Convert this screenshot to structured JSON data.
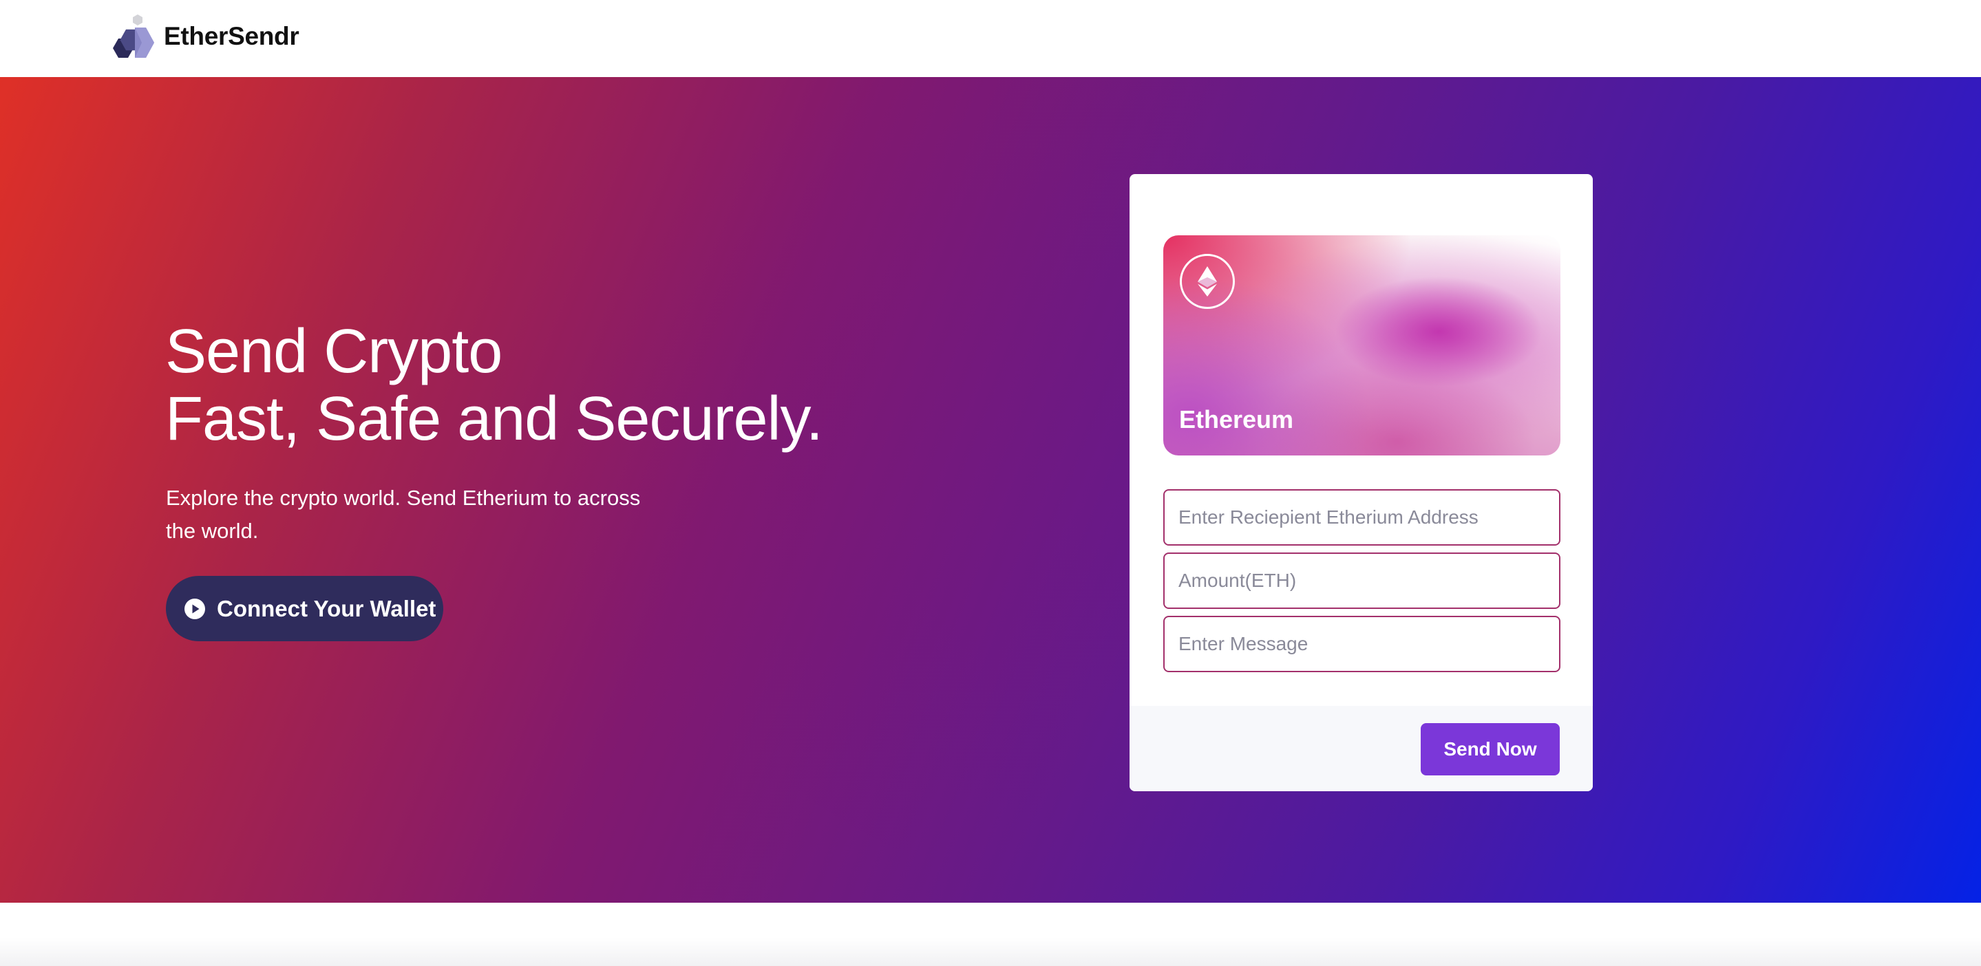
{
  "navbar": {
    "brand": "EtherSendr",
    "logo_icon": "hexagon-cluster-icon"
  },
  "hero": {
    "headline_line1": "Send Crypto",
    "headline_line2": "Fast, Safe and Securely.",
    "subtext": "Explore the crypto world. Send Etherium to across the world.",
    "connect_button": {
      "label": "Connect Your Wallet",
      "icon": "play-circle-icon"
    }
  },
  "transfer_card": {
    "eth_card": {
      "label": "Ethereum",
      "icon": "ethereum-icon"
    },
    "address_placeholder": "Enter Reciepient Etherium Address",
    "amount_placeholder": "Amount(ETH)",
    "message_placeholder": "Enter Message",
    "send_button_label": "Send Now"
  },
  "colors": {
    "gradient_start": "#df3027",
    "gradient_mid": "#81196f",
    "gradient_end": "#0422e6",
    "connect_button": "#2f2c5c",
    "send_button": "#7b37d9",
    "input_border": "#a3306b"
  }
}
